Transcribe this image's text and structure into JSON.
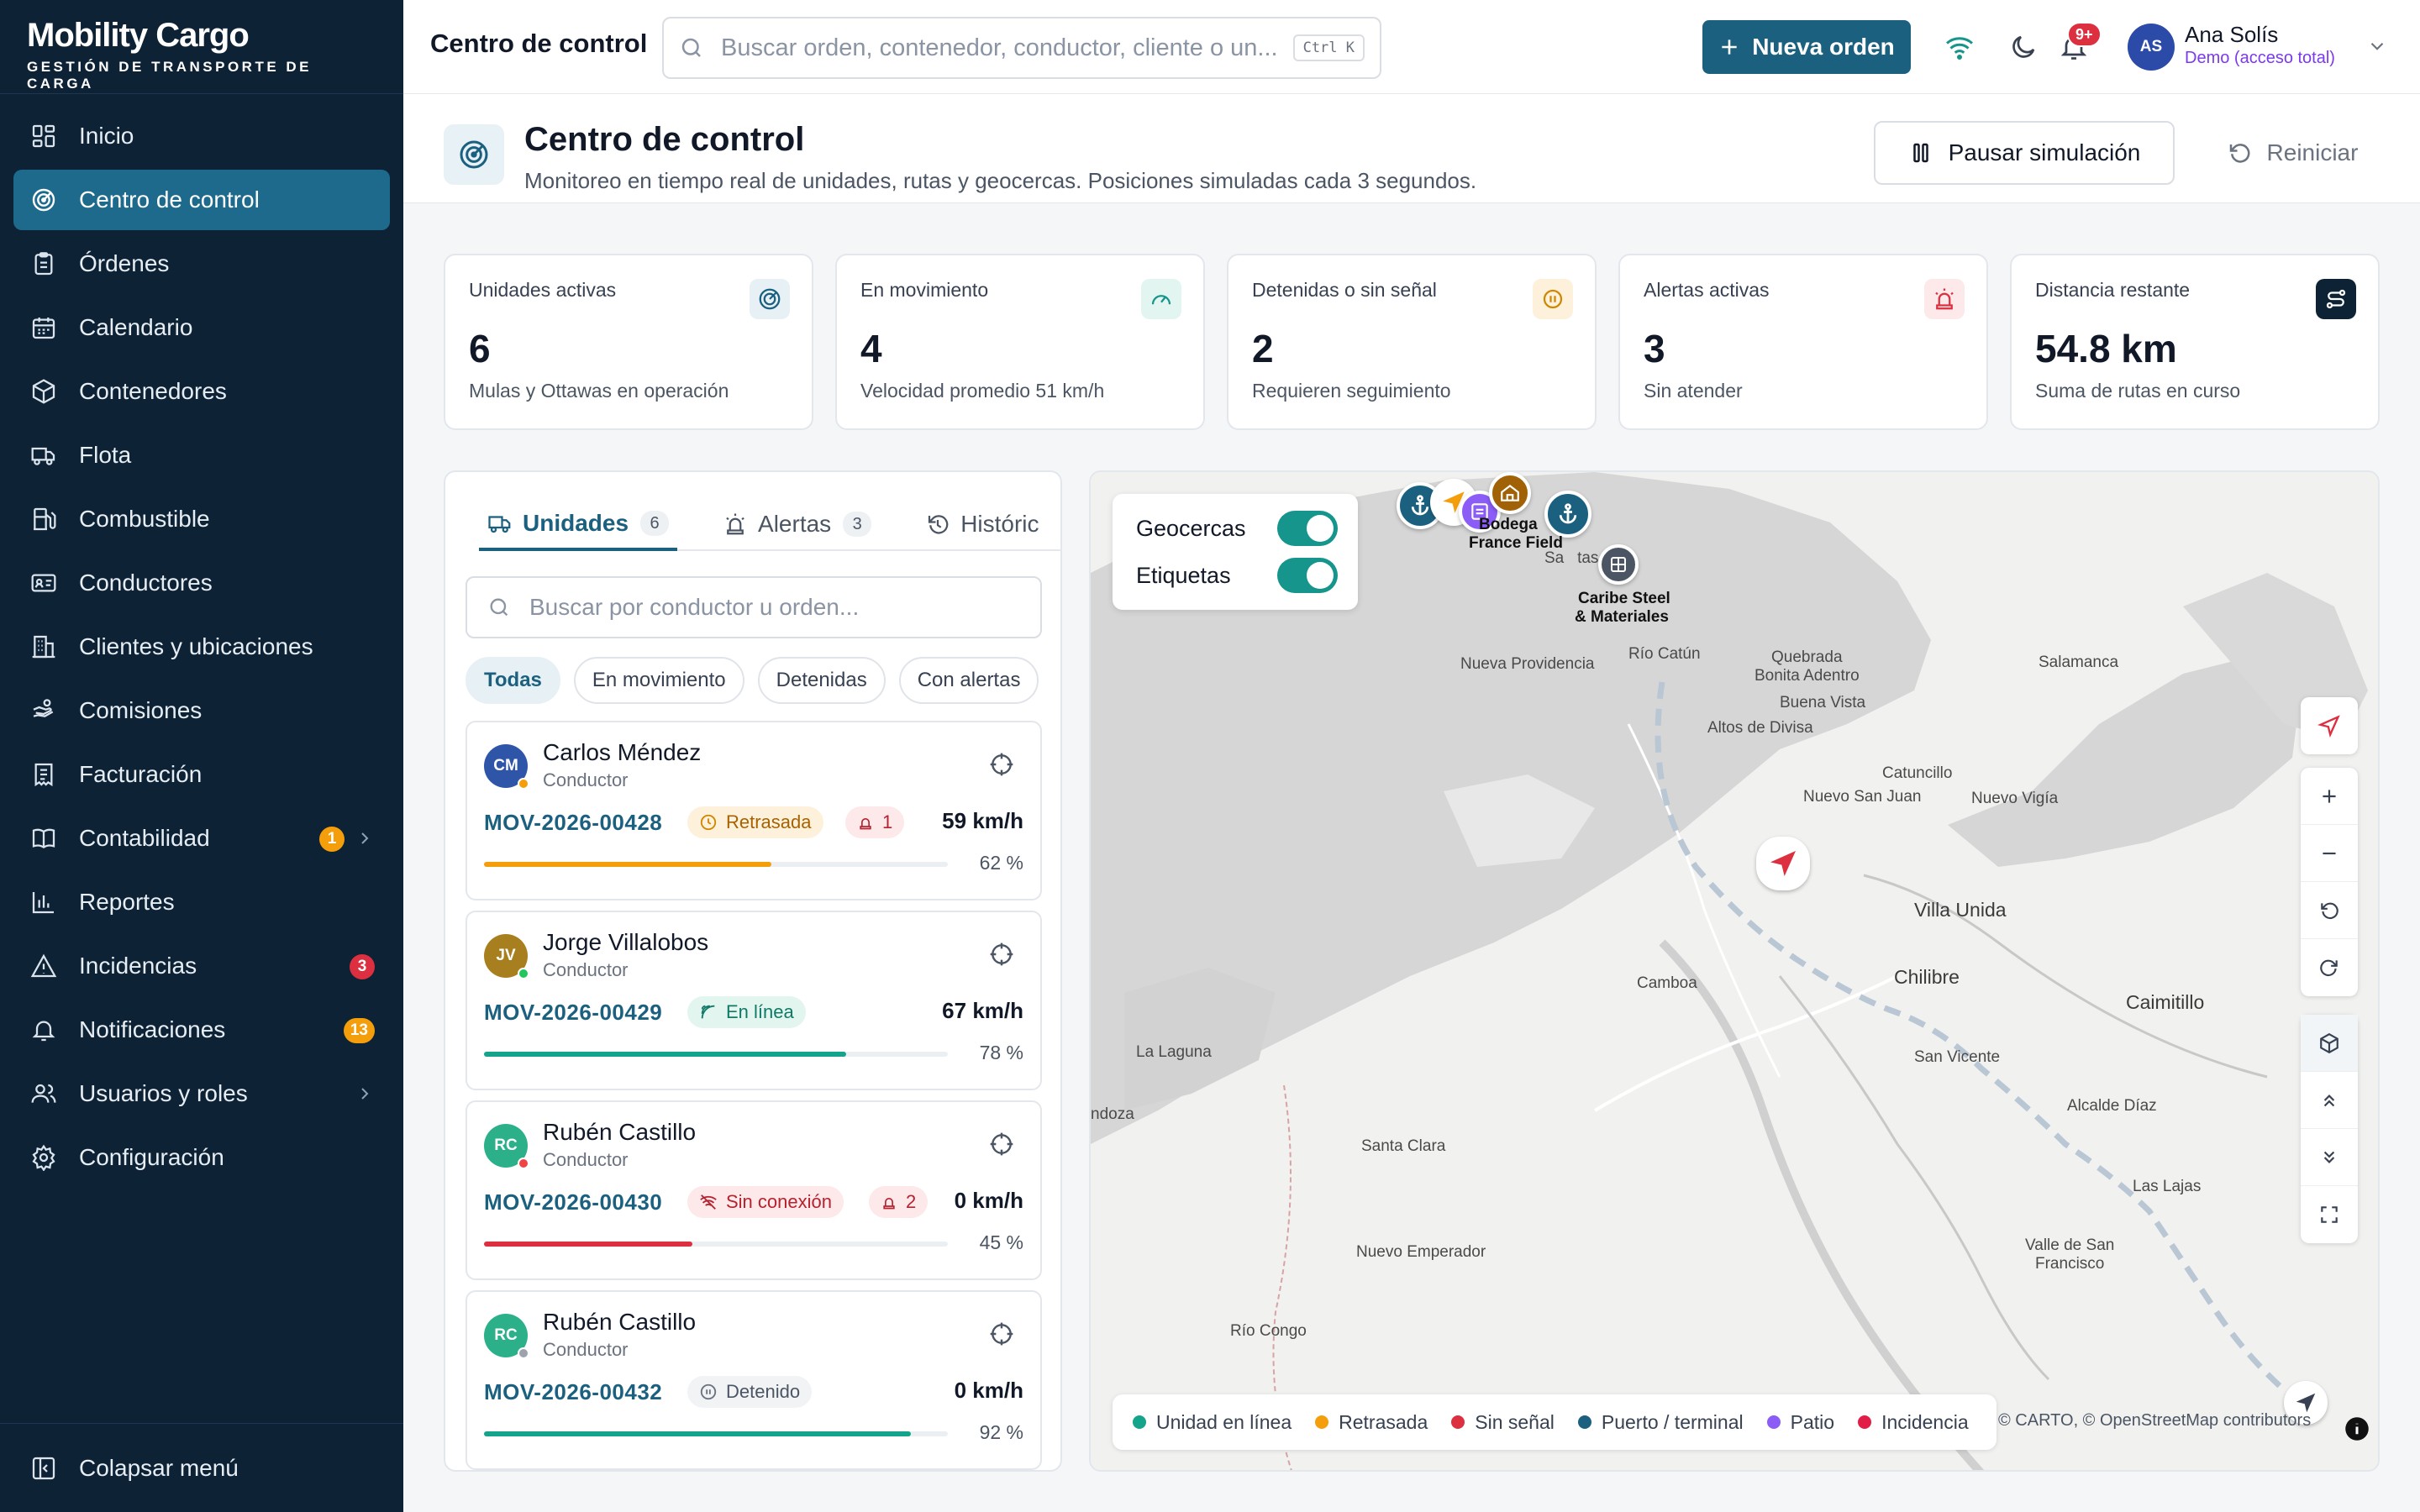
{
  "brand": {
    "title": "Mobility Cargo",
    "subtitle": "GESTIÓN DE TRANSPORTE DE CARGA"
  },
  "sidebar": {
    "items": [
      {
        "label": "Inicio",
        "icon": "dashboard-grid-icon"
      },
      {
        "label": "Centro de control",
        "icon": "radar-icon",
        "active": true
      },
      {
        "label": "Órdenes",
        "icon": "clipboard-icon"
      },
      {
        "label": "Calendario",
        "icon": "calendar-icon"
      },
      {
        "label": "Contenedores",
        "icon": "box-icon"
      },
      {
        "label": "Flota",
        "icon": "truck-icon"
      },
      {
        "label": "Combustible",
        "icon": "fuel-icon"
      },
      {
        "label": "Conductores",
        "icon": "id-card-icon"
      },
      {
        "label": "Clientes y ubicaciones",
        "icon": "building-icon"
      },
      {
        "label": "Comisiones",
        "icon": "coins-icon"
      },
      {
        "label": "Facturación",
        "icon": "receipt-icon"
      },
      {
        "label": "Contabilidad",
        "icon": "book-icon",
        "badge": "1"
      },
      {
        "label": "Reportes",
        "icon": "bar-chart-icon"
      },
      {
        "label": "Incidencias",
        "icon": "warning-icon",
        "badge": "3"
      },
      {
        "label": "Notificaciones",
        "icon": "bell-icon",
        "badge": "13"
      },
      {
        "label": "Usuarios y roles",
        "icon": "users-icon"
      },
      {
        "label": "Configuración",
        "icon": "gear-icon"
      }
    ],
    "collapse_label": "Colapsar menú"
  },
  "topbar": {
    "title": "Centro de control",
    "search_placeholder": "Buscar orden, contenedor, conductor, cliente o un...",
    "shortcut": "Ctrl K",
    "new_order": "Nueva orden",
    "notif_badge": "9+",
    "user": {
      "initials": "AS",
      "name": "Ana Solís",
      "role": "Demo (acceso total)"
    }
  },
  "header": {
    "title": "Centro de control",
    "subtitle": "Monitoreo en tiempo real de unidades, rutas y geocercas. Posiciones simuladas cada 3 segundos.",
    "pause_label": "Pausar simulación",
    "reset_label": "Reiniciar"
  },
  "stats": [
    {
      "label": "Unidades activas",
      "value": "6",
      "sub": "Mulas y Ottawas en operación"
    },
    {
      "label": "En movimiento",
      "value": "4",
      "sub": "Velocidad promedio 51 km/h"
    },
    {
      "label": "Detenidas o sin señal",
      "value": "2",
      "sub": "Requieren seguimiento"
    },
    {
      "label": "Alertas activas",
      "value": "3",
      "sub": "Sin atender"
    },
    {
      "label": "Distancia restante",
      "value": "54.8 km",
      "sub": "Suma de rutas en curso"
    }
  ],
  "panel": {
    "tabs": [
      {
        "label": "Unidades",
        "count": "6"
      },
      {
        "label": "Alertas",
        "count": "3"
      },
      {
        "label": "Histórico"
      }
    ],
    "search_placeholder": "Buscar por conductor u orden...",
    "filters": [
      "Todas",
      "En movimiento",
      "Detenidas",
      "Con alertas"
    ],
    "units": [
      {
        "initials": "CM",
        "name": "Carlos Méndez",
        "role": "Conductor",
        "order": "MOV-2026-00428",
        "status": "Retrasada",
        "alerts": "1",
        "speed": "59 km/h",
        "progress": 62,
        "progress_label": "62 %",
        "bar_color": "#f59e0b",
        "avatar_color": "#2e55a8",
        "dot_color": "#f59e0b"
      },
      {
        "initials": "JV",
        "name": "Jorge Villalobos",
        "role": "Conductor",
        "order": "MOV-2026-00429",
        "status": "En línea",
        "alerts": "",
        "speed": "67 km/h",
        "progress": 78,
        "progress_label": "78 %",
        "bar_color": "#14a38b",
        "avatar_color": "#a87f1e",
        "dot_color": "#22c55e"
      },
      {
        "initials": "RC",
        "name": "Rubén Castillo",
        "role": "Conductor",
        "order": "MOV-2026-00430",
        "status": "Sin conexión",
        "alerts": "2",
        "speed": "0 km/h",
        "progress": 45,
        "progress_label": "45 %",
        "bar_color": "#dc2f3f",
        "avatar_color": "#2bb08a",
        "dot_color": "#ef4444"
      },
      {
        "initials": "RC",
        "name": "Rubén Castillo",
        "role": "Conductor",
        "order": "MOV-2026-00432",
        "status": "Detenido",
        "alerts": "",
        "speed": "0 km/h",
        "progress": 92,
        "progress_label": "92 %",
        "bar_color": "#14a38b",
        "avatar_color": "#2bb08a",
        "dot_color": "#9ca3af"
      }
    ]
  },
  "map": {
    "toggles": [
      {
        "label": "Geocercas",
        "on": true
      },
      {
        "label": "Etiquetas",
        "on": true
      }
    ],
    "labels": [
      {
        "text": "Nueva Providencia"
      },
      {
        "text": "Río Catún"
      },
      {
        "text": "Quebrada"
      },
      {
        "text": "Bonita Adentro"
      },
      {
        "text": "Salamanca"
      },
      {
        "text": "Buena Vista"
      },
      {
        "text": "Altos de Divisa"
      },
      {
        "text": "Catuncillo"
      },
      {
        "text": "Nuevo San Juan"
      },
      {
        "text": "Nuevo Vigía"
      },
      {
        "text": "Villa Unida"
      },
      {
        "text": "Chilibre"
      },
      {
        "text": "Camboa"
      },
      {
        "text": "Caimitillo"
      },
      {
        "text": "La Laguna"
      },
      {
        "text": "San Vicente"
      },
      {
        "text": "ndoza"
      },
      {
        "text": "Alcalde Díaz"
      },
      {
        "text": "Santa Clara"
      },
      {
        "text": "Las Lajas"
      },
      {
        "text": "Nuevo Emperador"
      },
      {
        "text": "Valle de San"
      },
      {
        "text": "Francisco"
      },
      {
        "text": "Río Congo"
      },
      {
        "text": "Sa   tas"
      }
    ],
    "places": [
      {
        "text": "Bodega"
      },
      {
        "text": "France Field"
      },
      {
        "text": "Caribe Steel"
      },
      {
        "text": "& Materiales"
      }
    ],
    "legend": [
      {
        "label": "Unidad en línea",
        "color": "#14a38b"
      },
      {
        "label": "Retrasada",
        "color": "#f59e0b"
      },
      {
        "label": "Sin señal",
        "color": "#dc2f3f"
      },
      {
        "label": "Puerto / terminal",
        "color": "#1b617f"
      },
      {
        "label": "Patio",
        "color": "#8b5cf6"
      },
      {
        "label": "Incidencia",
        "color": "#e11d48"
      }
    ],
    "attribution": "© CARTO, © OpenStreetMap contributors"
  }
}
